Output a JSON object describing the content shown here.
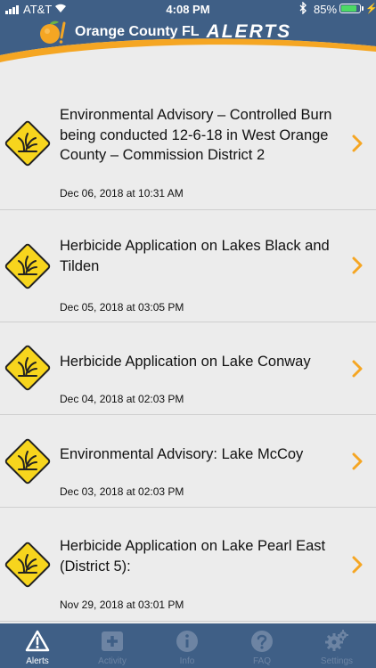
{
  "status_bar": {
    "carrier": "AT&T",
    "time": "4:08 PM",
    "battery": "85%",
    "battery_level": 0.85
  },
  "header": {
    "title": "Orange County FL",
    "subtitle": "ALERTS"
  },
  "alerts": [
    {
      "title": "Environmental Advisory – Controlled Burn being conducted 12-6-18 in West Orange County – Commission District 2",
      "date": "Dec 06, 2018 at 10:31 AM"
    },
    {
      "title": "Herbicide Application on Lakes Black and Tilden",
      "date": "Dec 05, 2018 at 03:05 PM"
    },
    {
      "title": "Herbicide Application on Lake Conway",
      "date": "Dec 04, 2018 at 02:03 PM"
    },
    {
      "title": "Environmental Advisory: Lake McCoy",
      "date": "Dec 03, 2018 at 02:03 PM"
    },
    {
      "title": "Herbicide Application on Lake Pearl East (District 5):",
      "date": "Nov 29, 2018 at 03:01 PM"
    }
  ],
  "tabs": [
    {
      "label": "Alerts",
      "icon": "warning-icon",
      "active": true
    },
    {
      "label": "Activity",
      "icon": "plus-icon",
      "active": false
    },
    {
      "label": "Info",
      "icon": "info-icon",
      "active": false
    },
    {
      "label": "FAQ",
      "icon": "question-icon",
      "active": false
    },
    {
      "label": "Settings",
      "icon": "gear-icon",
      "active": false
    }
  ],
  "colors": {
    "header_blue": "#3f5f86",
    "accent_orange": "#f5a623",
    "warning_yellow": "#f7d51d"
  }
}
